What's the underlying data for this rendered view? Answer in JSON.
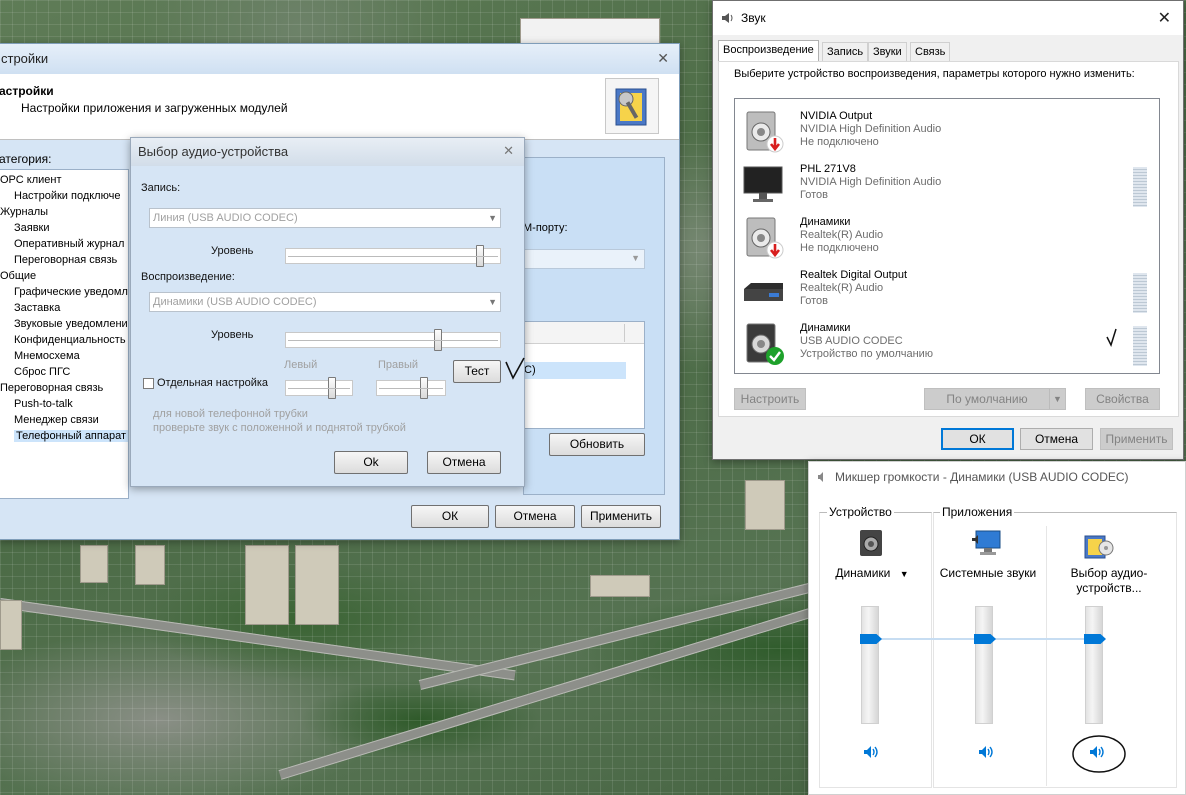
{
  "colors": {
    "accent": "#0078d7",
    "selection": "#cce4fb",
    "panel_blue": "#d6e5f5",
    "status_ok": "#1ea12b",
    "status_off": "#d81e1e"
  },
  "settings_window": {
    "title": "стройки",
    "header_title": "астройки",
    "header_subtitle": "Настройки приложения и загруженных модулей",
    "category_label": "атегория:",
    "tree": [
      {
        "label": "ОРС клиент",
        "level": 0
      },
      {
        "label": "Настройки подключе",
        "level": 1
      },
      {
        "label": "Журналы",
        "level": 0
      },
      {
        "label": "Заявки",
        "level": 1
      },
      {
        "label": "Оперативный журнал",
        "level": 1
      },
      {
        "label": "Переговорная связь",
        "level": 1
      },
      {
        "label": "Общие",
        "level": 0
      },
      {
        "label": "Графические уведомле",
        "level": 1
      },
      {
        "label": "Заставка",
        "level": 1
      },
      {
        "label": "Звуковые уведомлени",
        "level": 1
      },
      {
        "label": "Конфиденциальность",
        "level": 1
      },
      {
        "label": "Мнемосхема",
        "level": 1
      },
      {
        "label": "Сброс ПГС",
        "level": 1
      },
      {
        "label": "Переговорная связь",
        "level": 0
      },
      {
        "label": "Push-to-talk",
        "level": 1
      },
      {
        "label": "Менеджер связи",
        "level": 1
      },
      {
        "label": "Телефонный аппарат",
        "level": 1,
        "selected": true
      }
    ],
    "com_port_label": "М-порту:",
    "list_selected_fragment": "С)",
    "refresh_button": "Обновить",
    "ok_button": "ОК",
    "cancel_button": "Отмена",
    "apply_button": "Применить"
  },
  "audio_dialog": {
    "title": "Выбор аудио-устройства",
    "record_label": "Запись:",
    "record_device": "Линия (USB AUDIO  CODEC)",
    "record_level_label": "Уровень",
    "record_level": 0.92,
    "playback_label": "Воспроизведение:",
    "playback_device": "Динамики (USB AUDIO  CODEC)",
    "playback_level_label": "Уровень",
    "playback_level": 0.72,
    "separate_checkbox_label": "Отдельная настройка",
    "separate_checked": false,
    "left_label": "Левый",
    "right_label": "Правый",
    "left_level": 0.72,
    "right_level": 0.72,
    "test_button": "Тест",
    "hint_line1": "для новой телефонной трубки",
    "hint_line2": "проверьте звук с положенной и поднятой трубкой",
    "ok_button": "Ok",
    "cancel_button": "Отмена"
  },
  "sound_dialog": {
    "title": "Звук",
    "tabs": [
      {
        "label": "Воспроизведение",
        "active": true
      },
      {
        "label": "Запись"
      },
      {
        "label": "Звуки"
      },
      {
        "label": "Связь"
      }
    ],
    "prompt": "Выберите устройство воспроизведения, параметры которого нужно изменить:",
    "devices": [
      {
        "name": "NVIDIA Output",
        "driver": "NVIDIA High Definition Audio",
        "status": "Не подключено",
        "icon": "speaker-disconnected-icon",
        "meter": false
      },
      {
        "name": "PHL 271V8",
        "driver": "NVIDIA High Definition Audio",
        "status": "Готов",
        "icon": "monitor-icon",
        "meter": true
      },
      {
        "name": "Динамики",
        "driver": "Realtek(R) Audio",
        "status": "Не подключено",
        "icon": "speaker-disconnected-icon",
        "meter": false
      },
      {
        "name": "Realtek Digital Output",
        "driver": "Realtek(R) Audio",
        "status": "Готов",
        "icon": "digital-output-icon",
        "meter": true
      },
      {
        "name": "Динамики",
        "driver": "USB AUDIO  CODEC",
        "status": "Устройство по умолчанию",
        "icon": "speaker-default-icon",
        "meter": true
      }
    ],
    "configure_button": "Настроить",
    "default_button": "По умолчанию",
    "properties_button": "Свойства",
    "ok_button": "ОК",
    "cancel_button": "Отмена",
    "apply_button": "Применить"
  },
  "mixer": {
    "title": "Микшер громкости - Динамики (USB AUDIO  CODEC)",
    "device_section": "Устройство",
    "apps_section": "Приложения",
    "channels": [
      {
        "name": "Динамики",
        "level": 0.75,
        "dropdown": true
      },
      {
        "name": "Системные звуки",
        "level": 0.75
      },
      {
        "name": "Выбор аудио-устройств...",
        "level": 0.75
      }
    ]
  }
}
